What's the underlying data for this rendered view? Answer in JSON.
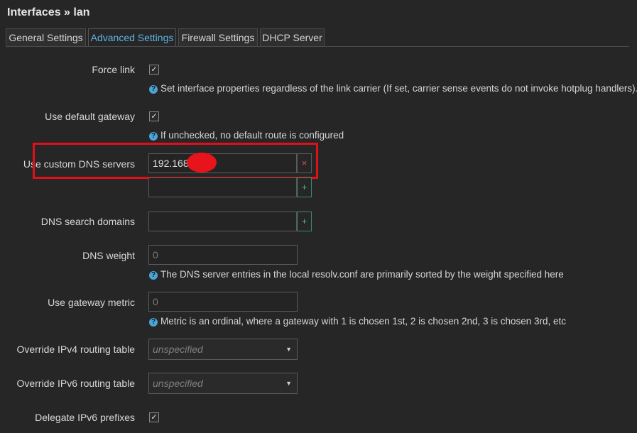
{
  "page": {
    "title": "Interfaces » lan"
  },
  "tabs": [
    {
      "label": "General Settings"
    },
    {
      "label": "Advanced Settings"
    },
    {
      "label": "Firewall Settings"
    },
    {
      "label": "DHCP Server"
    }
  ],
  "form": {
    "force_link": {
      "label": "Force link",
      "checked": true,
      "help": "Set interface properties regardless of the link carrier (If set, carrier sense events do not invoke hotplug handlers)."
    },
    "default_gateway": {
      "label": "Use default gateway",
      "checked": true,
      "help": "If unchecked, no default route is configured"
    },
    "custom_dns": {
      "label": "Use custom DNS servers",
      "value": "192.168",
      "remove_icon": "×",
      "add_icon": "+"
    },
    "dns_search": {
      "label": "DNS search domains",
      "add_icon": "+"
    },
    "dns_weight": {
      "label": "DNS weight",
      "placeholder": "0",
      "help": "The DNS server entries in the local resolv.conf are primarily sorted by the weight specified here"
    },
    "gateway_metric": {
      "label": "Use gateway metric",
      "placeholder": "0",
      "help": "Metric is an ordinal, where a gateway with 1 is chosen 1st, 2 is chosen 2nd, 3 is chosen 3rd, etc"
    },
    "ipv4_table": {
      "label": "Override IPv4 routing table",
      "selected": "unspecified"
    },
    "ipv6_table": {
      "label": "Override IPv6 routing table",
      "selected": "unspecified"
    },
    "delegate_ipv6": {
      "label": "Delegate IPv6 prefixes",
      "checked": true
    }
  },
  "icons": {
    "checkmark": "✓",
    "help": "?",
    "caret": "▼"
  },
  "colors": {
    "accent": "#5fb2e6",
    "highlight": "#e0101a",
    "add": "#4fb88a",
    "remove": "#d9534f"
  }
}
